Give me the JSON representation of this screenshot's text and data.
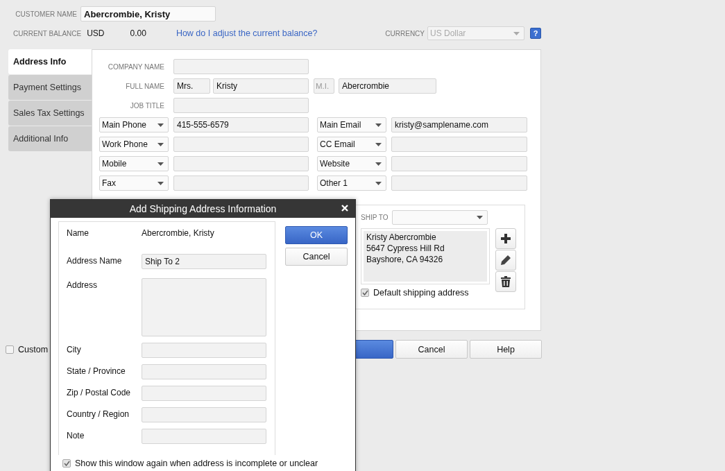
{
  "customer": {
    "label": "CUSTOMER NAME",
    "value": "Abercrombie, Kristy"
  },
  "balance": {
    "label": "CURRENT BALANCE",
    "currency_code": "USD",
    "amount": "0.00",
    "help_link": "How do I adjust the current balance?"
  },
  "currency": {
    "label": "CURRENCY",
    "value": "US Dollar",
    "disabled": true,
    "help_button": "?"
  },
  "tabs": [
    {
      "label": "Address Info",
      "selected": true
    },
    {
      "label": "Payment Settings",
      "selected": false
    },
    {
      "label": "Sales Tax Settings",
      "selected": false
    },
    {
      "label": "Additional Info",
      "selected": false
    }
  ],
  "company": {
    "label": "COMPANY NAME"
  },
  "full_name": {
    "label": "FULL NAME",
    "title": "Mrs.",
    "first": "Kristy",
    "middle_placeholder": "M.I.",
    "last": "Abercrombie"
  },
  "job_title": {
    "label": "JOB TITLE"
  },
  "contact_rows": [
    {
      "left": {
        "type": "Main Phone",
        "value": "415-555-6579"
      },
      "right": {
        "type": "Main Email",
        "value": "kristy@samplename.com"
      }
    },
    {
      "left": {
        "type": "Work Phone"
      },
      "right": {
        "type": "CC Email"
      }
    },
    {
      "left": {
        "type": "Mobile"
      },
      "right": {
        "type": "Website"
      }
    },
    {
      "left": {
        "type": "Fax"
      },
      "right": {
        "type": "Other 1"
      }
    }
  ],
  "ship_to": {
    "label": "SHIP TO",
    "address_lines": [
      "Kristy Abercrombie",
      "5647 Cypress Hill Rd",
      "Bayshore, CA 94326"
    ],
    "default_label": "Default shipping address",
    "default_checked": true
  },
  "inactive": {
    "label": "Custom",
    "checked": false
  },
  "footer_buttons": [
    {
      "kind": "primary"
    },
    {
      "kind": "normal",
      "label": "Cancel"
    },
    {
      "kind": "normal",
      "label": "Help"
    }
  ],
  "dialog": {
    "title": "Add Shipping Address Information",
    "fields": [
      {
        "kind": "text",
        "label": "Name",
        "value": "Abercrombie, Kristy"
      },
      {
        "kind": "input",
        "label": "Address Name",
        "value": "Ship To 2"
      },
      {
        "kind": "textarea",
        "label": "Address"
      },
      {
        "kind": "input",
        "label": "City"
      },
      {
        "kind": "input",
        "label": "State / Province"
      },
      {
        "kind": "input",
        "label": "Zip / Postal Code"
      },
      {
        "kind": "input",
        "label": "Country / Region"
      },
      {
        "kind": "input",
        "label": "Note"
      }
    ],
    "buttons": [
      {
        "kind": "primary",
        "label": "OK"
      },
      {
        "kind": "normal",
        "label": "Cancel"
      }
    ],
    "show_again": {
      "label": "Show this window again when address is incomplete or unclear",
      "checked": true
    }
  }
}
